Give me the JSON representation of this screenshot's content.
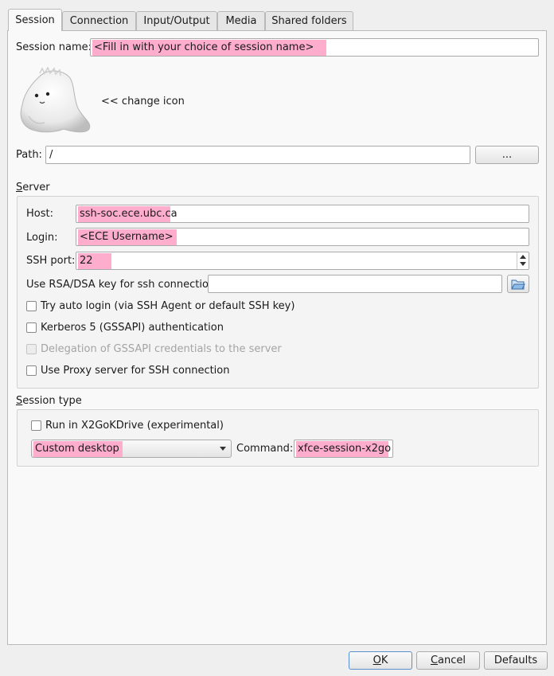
{
  "tabs": [
    {
      "label": "Session"
    },
    {
      "label": "Connection"
    },
    {
      "label": "Input/Output"
    },
    {
      "label": "Media"
    },
    {
      "label": "Shared folders"
    }
  ],
  "session": {
    "name_label": "Session name:",
    "name_value": "<Fill in with your choice of session name>",
    "change_icon_label": "<< change icon",
    "path_label": "Path:",
    "path_value": "/",
    "browse_label": "..."
  },
  "server": {
    "title": "Server",
    "host_label": "Host:",
    "host_value": "ssh-soc.ece.ubc.ca",
    "login_label": "Login:",
    "login_value": "<ECE Username>",
    "port_label": "SSH port:",
    "port_value": "22",
    "key_label": "Use RSA/DSA key for ssh connection:",
    "key_value": "",
    "options": [
      {
        "label": "Try auto login (via SSH Agent or default SSH key)",
        "checked": false,
        "enabled": true
      },
      {
        "label": "Kerberos 5 (GSSAPI) authentication",
        "checked": false,
        "enabled": true
      },
      {
        "label": "Delegation of GSSAPI credentials to the server",
        "checked": false,
        "enabled": false
      },
      {
        "label": "Use Proxy server for SSH connection",
        "checked": false,
        "enabled": true
      }
    ]
  },
  "session_type": {
    "title": "Session type",
    "kdrive_label": "Run in X2GoKDrive (experimental)",
    "type_value": "Custom desktop",
    "command_label": "Command:",
    "command_value": "xfce-session-x2go"
  },
  "buttons": {
    "ok": "OK",
    "cancel": "Cancel",
    "defaults": "Defaults"
  },
  "colors": {
    "highlight": "#ffadcc",
    "panel": "#f9f9f9",
    "window": "#efefef"
  }
}
